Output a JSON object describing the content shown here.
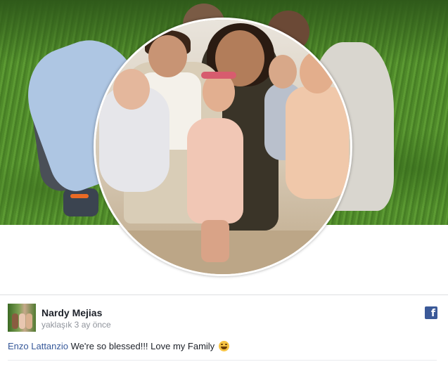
{
  "post": {
    "author": "Nardy Mejias",
    "timestamp": "yaklaşık 3 ay önce",
    "mention": "Enzo Lattanzio",
    "text": "We're so blessed!!! Love my Family",
    "emoji": "grinning-face-emoji",
    "platform_icon": "facebook-icon"
  },
  "colors": {
    "author_text": "#1d2129",
    "timestamp": "#90949c",
    "mention_link": "#365899",
    "facebook_blue": "#3b5998"
  }
}
